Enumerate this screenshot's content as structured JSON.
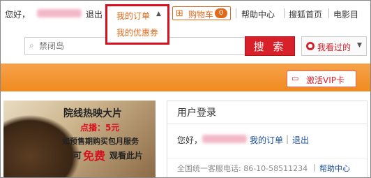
{
  "topbar": {
    "greeting": "您好，",
    "logout": "退出",
    "cart_label": "购物车",
    "cart_count": "0",
    "help": "帮助中心",
    "sohu_home": "搜狐首页",
    "movie": "电影目"
  },
  "dropdown": {
    "items": [
      "我的订单",
      "我的优惠券"
    ],
    "highlight_color": "#d8101e"
  },
  "search": {
    "placeholder": "禁闭岛",
    "button_label": "搜 索",
    "history_label": "我看过的"
  },
  "vip": {
    "label": "激活VIP卡"
  },
  "ad": {
    "title": "院线热映大片",
    "price": "点播：5元",
    "line3": "如预售期购买包月服务",
    "free_prefix": "可",
    "free_word": "免费",
    "free_suffix": "观看此片"
  },
  "login": {
    "title": "用户登录",
    "greeting": "您好，",
    "my_orders": "我的订单",
    "logout": "退出",
    "hotline": "全国统一客服电话: 86-10-58511234",
    "help": "帮助中心"
  },
  "colors": {
    "accent_orange": "#f08a1e",
    "brand_red": "#d8202a",
    "link_blue": "#1a4d9a"
  }
}
